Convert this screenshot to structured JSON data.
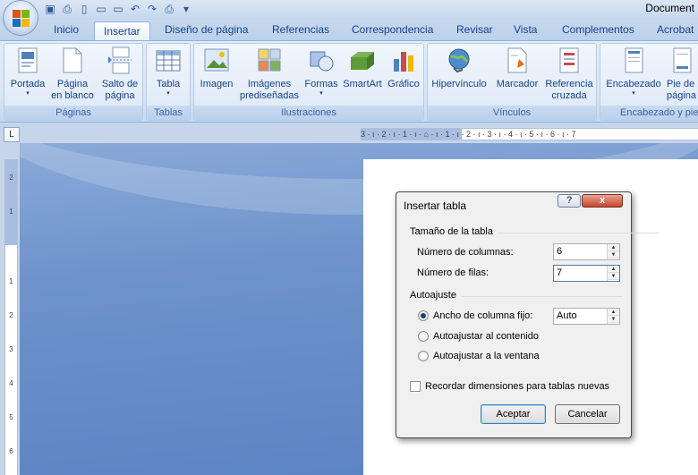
{
  "window": {
    "title": "Document"
  },
  "tabs": [
    "Inicio",
    "Insertar",
    "Diseño de página",
    "Referencias",
    "Correspondencia",
    "Revisar",
    "Vista",
    "Complementos",
    "Acrobat"
  ],
  "active_tab": "Insertar",
  "ribbon": {
    "groups": {
      "paginas": "Páginas",
      "tablas": "Tablas",
      "ilustraciones": "Ilustraciones",
      "vinculos": "Vínculos",
      "encabezado": "Encabezado y pie"
    },
    "buttons": {
      "portada": "Portada",
      "pagina_l1": "Página",
      "pagina_l2": "en blanco",
      "salto_l1": "Salto de",
      "salto_l2": "página",
      "tabla": "Tabla",
      "imagen": "Imagen",
      "imagenes_l1": "Imágenes",
      "imagenes_l2": "prediseñadas",
      "formas": "Formas",
      "smartart": "SmartArt",
      "grafico": "Gráfico",
      "hipervinculo": "Hipervínculo",
      "marcador": "Marcador",
      "referencia_l1": "Referencia",
      "referencia_l2": "cruzada",
      "encabezado": "Encabezado",
      "pie_l1": "Pie de",
      "pie_l2": "página"
    }
  },
  "rulers": {
    "corner": "L",
    "horizontal": "3 · ı · 2 · ı · 1 · ı · ⌂ · ı · 1 · ı · 2 · ı · 3 · ı · 4 · ı · 5 · ı · 6 · ı · 7",
    "vertical": [
      "2",
      "1",
      "1",
      "2",
      "3",
      "4",
      "5",
      "6"
    ]
  },
  "dialog": {
    "title": "Insertar tabla",
    "help": "?",
    "close": "x",
    "section_size": "Tamaño de la tabla",
    "columns_label": "Número de columnas:",
    "columns_value": "6",
    "rows_label": "Número de filas:",
    "rows_value": "7",
    "section_autofit": "Autoajuste",
    "fixed_width_label": "Ancho de columna fijo:",
    "fixed_width_value": "Auto",
    "autofit_content_label": "Autoajustar al contenido",
    "autofit_window_label": "Autoajustar a la ventana",
    "remember_label": "Recordar dimensiones para tablas nuevas",
    "remember_checked": false,
    "selected_autofit": "fixed",
    "ok": "Aceptar",
    "cancel": "Cancelar"
  }
}
